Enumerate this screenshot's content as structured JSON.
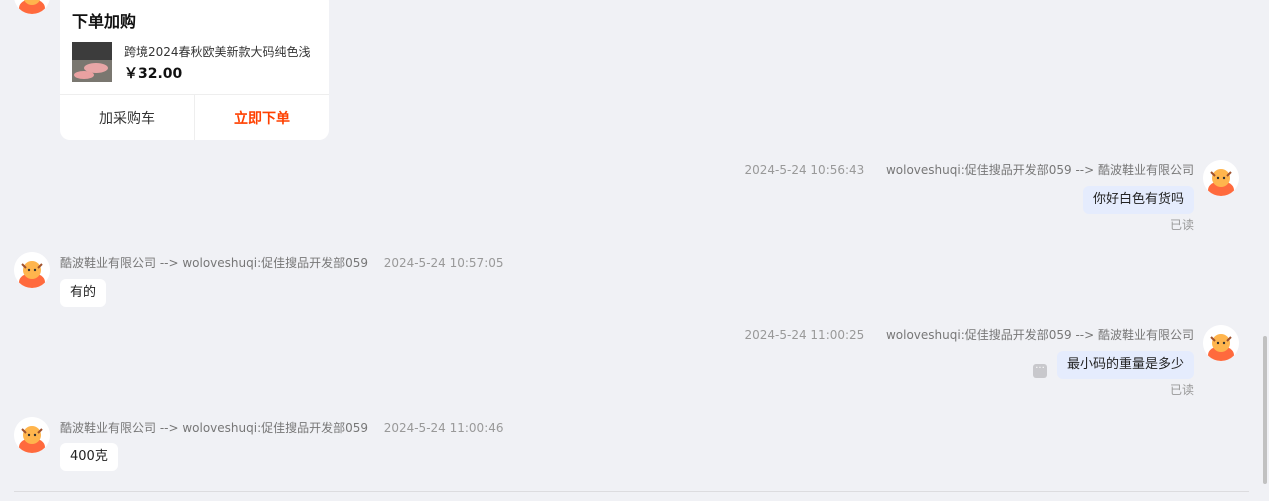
{
  "card": {
    "title": "下单加购",
    "product_name": "跨境2024春秋欧美新款大码纯色浅",
    "price": "￥32.00",
    "cart_label": "加采购车",
    "order_label": "立即下单"
  },
  "messages": [
    {
      "time": "2024-5-24 10:56:43",
      "route": "woloveshuqi:促佳搜品开发部059 --> 酷波鞋业有限公司",
      "text": "你好白色有货吗",
      "status": "已读"
    },
    {
      "route": "酷波鞋业有限公司 --> woloveshuqi:促佳搜品开发部059",
      "time": "2024-5-24 10:57:05",
      "text": "有的"
    },
    {
      "time": "2024-5-24 11:00:25",
      "route": "woloveshuqi:促佳搜品开发部059 --> 酷波鞋业有限公司",
      "text": "最小码的重量是多少",
      "status": "已读"
    },
    {
      "route": "酷波鞋业有限公司 --> woloveshuqi:促佳搜品开发部059",
      "time": "2024-5-24 11:00:46",
      "text": "400克"
    }
  ],
  "icons": {
    "more": "more-icon",
    "avatar": "mascot-avatar-icon"
  },
  "colors": {
    "accent": "#ff4000",
    "outgoing_bubble": "#e5ecfd",
    "avatar": "#ff6a3d"
  }
}
